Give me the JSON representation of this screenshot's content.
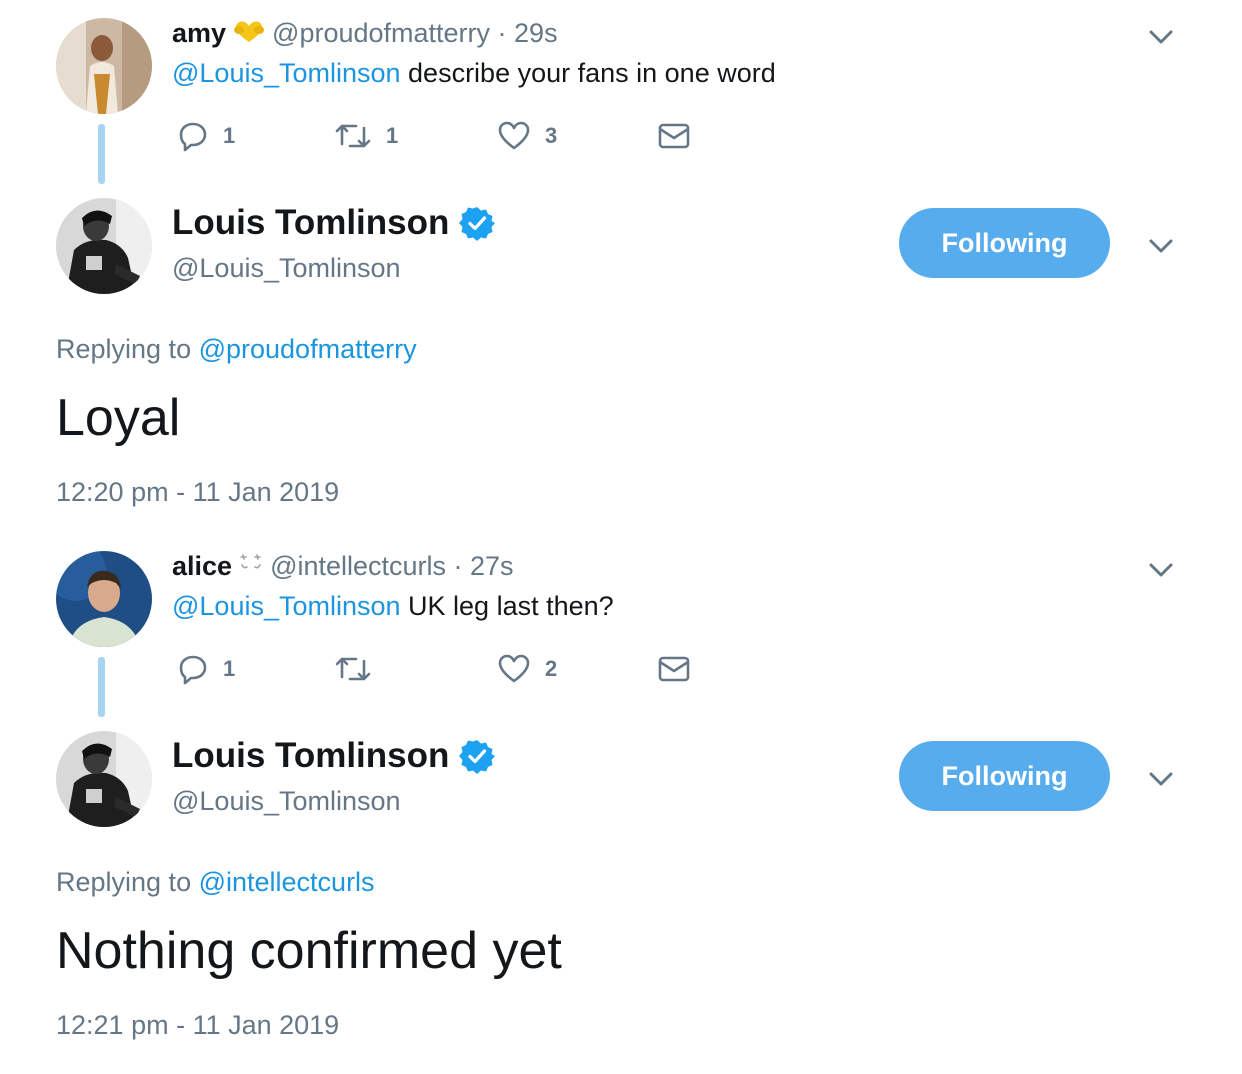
{
  "threads": [
    {
      "reply": {
        "name": "amy",
        "emoji_icon": "yellow-heart-hands-emoji",
        "handle_time": "@proudofmatterry · 29s",
        "mention": "@Louis_Tomlinson",
        "text": " describe your fans in one word",
        "actions": {
          "replies": "1",
          "retweets": "1",
          "likes": "3"
        }
      },
      "main": {
        "name": "Louis Tomlinson",
        "handle": "@Louis_Tomlinson",
        "follow_label": "Following",
        "replying_prefix": "Replying to ",
        "replying_handle": "@proudofmatterry",
        "text": "Loyal",
        "timestamp": "12:20 pm - 11 Jan 2019"
      }
    },
    {
      "reply": {
        "name": "alice",
        "emoji_icon": "sparkle-emoji",
        "handle_time": "@intellectcurls · 27s",
        "mention": "@Louis_Tomlinson",
        "text": " UK leg last then?",
        "actions": {
          "replies": "1",
          "retweets": "",
          "likes": "2"
        }
      },
      "main": {
        "name": "Louis Tomlinson",
        "handle": "@Louis_Tomlinson",
        "follow_label": "Following",
        "replying_prefix": "Replying to ",
        "replying_handle": "@intellectcurls",
        "text": "Nothing confirmed yet",
        "timestamp": "12:21 pm - 11 Jan 2019"
      }
    }
  ],
  "colors": {
    "accent": "#1b95e0",
    "button": "#57acee",
    "muted": "#657786",
    "thread_line": "#a9d3f2",
    "verified": "#1da1f2"
  }
}
